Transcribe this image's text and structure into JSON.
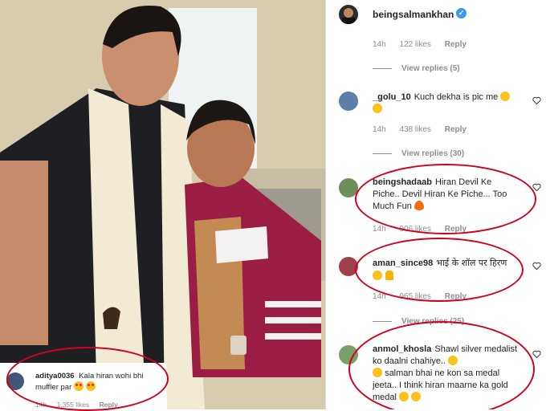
{
  "post": {
    "author": "beingsalmankhan",
    "verified_icon": "verified-badge-icon"
  },
  "top_meta": {
    "time": "14h",
    "likes": "122 likes",
    "reply": "Reply"
  },
  "view_replies_1": "View replies (5)",
  "comments": [
    {
      "username": "_golu_10",
      "text": "Kuch dekha is pic me",
      "emoji": [
        "laughing-emoji",
        "laughing-emoji"
      ],
      "time": "14h",
      "likes": "438 likes",
      "reply": "Reply",
      "view_replies": "View replies (30)"
    },
    {
      "username": "beingshadaab",
      "text": "Hiran Devil Ke Piche.. Devil Hiran Ke Piche... Too Much Fun",
      "emoji": [
        "fire-emoji"
      ],
      "time": "14h",
      "likes": "906 likes",
      "reply": "Reply"
    },
    {
      "username": "aman_since98",
      "text": "भाई के शॉल पर हिरण",
      "emoji": [
        "laughing-emoji",
        "folded-hands-emoji"
      ],
      "time": "14h",
      "likes": "965 likes",
      "reply": "Reply",
      "view_replies": "View replies (25)"
    },
    {
      "username": "anmol_khosla",
      "text": "Shawl silver medalist ko daalni chahiye..",
      "text2": "salman bhai ne kon sa medal jeeta..",
      "text3": "I think hiran maarne ka gold medal",
      "emoji": [
        "laughing-emoji",
        "laughing-emoji",
        "laughing-emoji",
        "laughing-emoji"
      ]
    }
  ],
  "overlay_comment": {
    "username": "aditya0036",
    "text": "Kala hiran wohi bhi muffler par",
    "emoji": [
      "heart-eyes-emoji",
      "heart-eyes-emoji"
    ],
    "time": "14h",
    "likes": "1,355 likes",
    "reply": "Reply"
  },
  "colors": {
    "annotation": "#d0021b",
    "verified": "#3897f0",
    "muted": "#8e8e8e"
  }
}
